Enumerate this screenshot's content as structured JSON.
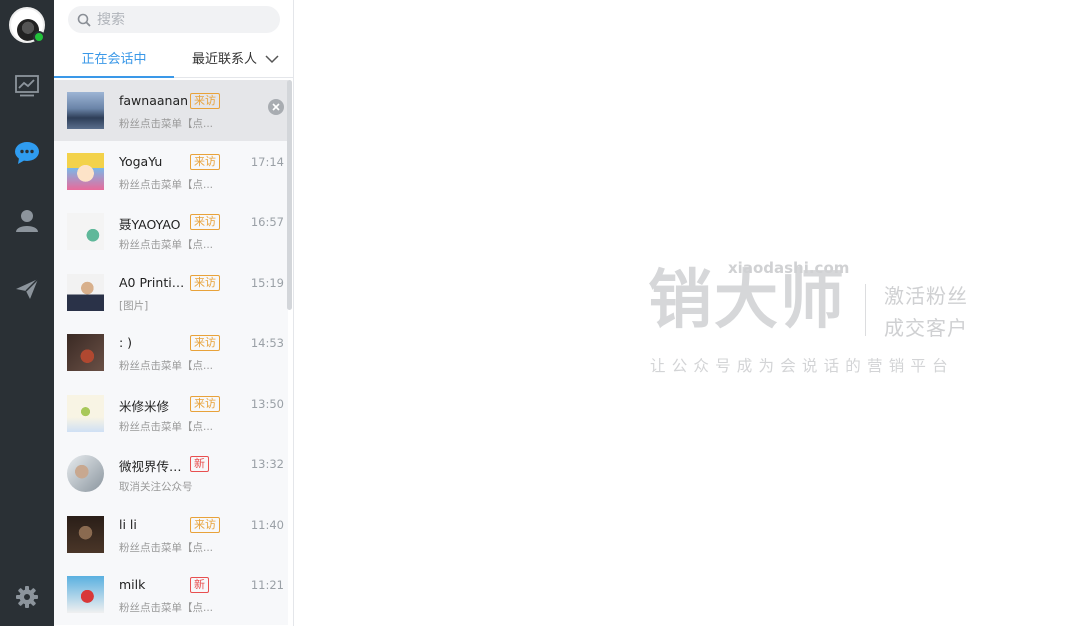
{
  "search": {
    "placeholder": "搜索"
  },
  "tabs": {
    "active": "正在会话中",
    "recent": "最近联系人"
  },
  "conversations": [
    {
      "name": "fawnaanan",
      "badge": "来访",
      "badge_type": "visit",
      "time": "",
      "preview": "粉丝点击菜单【点...",
      "selected": true
    },
    {
      "name": "YogaYu",
      "badge": "来访",
      "badge_type": "visit",
      "time": "17:14",
      "preview": "粉丝点击菜单【点..."
    },
    {
      "name": "聂YAOYAO",
      "badge": "来访",
      "badge_type": "visit",
      "time": "16:57",
      "preview": "粉丝点击菜单【点..."
    },
    {
      "name": "A0 Printin...",
      "badge": "来访",
      "badge_type": "visit",
      "time": "15:19",
      "preview": "[图片]"
    },
    {
      "name": ": )",
      "badge": "来访",
      "badge_type": "visit",
      "time": "14:53",
      "preview": "粉丝点击菜单【点..."
    },
    {
      "name": "米修米修",
      "badge": "来访",
      "badge_type": "visit",
      "time": "13:50",
      "preview": "粉丝点击菜单【点..."
    },
    {
      "name": "微视界传媒...",
      "badge": "新",
      "badge_type": "new",
      "time": "13:32",
      "preview": "取消关注公众号"
    },
    {
      "name": "li li",
      "badge": "来访",
      "badge_type": "visit",
      "time": "11:40",
      "preview": "粉丝点击菜单【点..."
    },
    {
      "name": "milk",
      "badge": "新",
      "badge_type": "new",
      "time": "11:21",
      "preview": "粉丝点击菜单【点..."
    }
  ],
  "brand": {
    "logo_text": "销大师",
    "domain": "xiaodashi.com",
    "slogan_line1": "激活粉丝",
    "slogan_line2": "成交客户",
    "tagline": "让公众号成为会说话的营销平台"
  },
  "colors": {
    "rail": "#2a3035",
    "accent": "#3a98e8",
    "badge_visit": "#e8a23a",
    "badge_new": "#e85050",
    "online": "#22c23a"
  },
  "icons": [
    "chart-icon",
    "chat-icon",
    "user-icon",
    "send-icon",
    "gear-icon",
    "search-icon",
    "chevron-down-icon",
    "close-icon"
  ]
}
